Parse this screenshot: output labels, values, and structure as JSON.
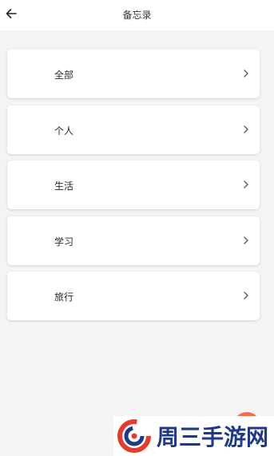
{
  "header": {
    "title": "备忘录",
    "back_icon": "arrow-left-icon"
  },
  "categories": [
    {
      "label": "全部"
    },
    {
      "label": "个人"
    },
    {
      "label": "生活"
    },
    {
      "label": "学习"
    },
    {
      "label": "旅行"
    }
  ],
  "watermark": {
    "text": "周三手游网"
  },
  "colors": {
    "background": "#f4f4f4",
    "card": "#ffffff",
    "fab": "#f36d4e",
    "watermark_text": "#1d3a8a",
    "watermark_red": "#e63a2c"
  }
}
